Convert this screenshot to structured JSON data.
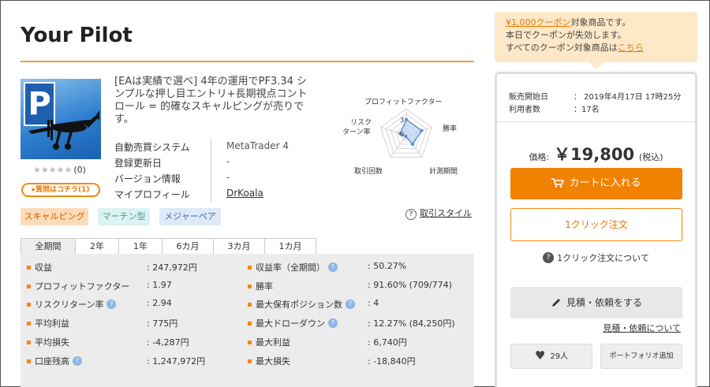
{
  "product": {
    "title": "Your Pilot",
    "description": "[EAは実績で選べ] 4年の運用でPF3.34 シンプルな押し目エントリ+長期視点コントロール = 的確なスキャルピングが売りです。",
    "rating_stars": "★★★★★",
    "rating_count": "(0)",
    "question_button": "▸質問はコチラ(1)",
    "info": [
      {
        "key": "自動売買システム",
        "value": "MetaTrader 4"
      },
      {
        "key": "登録更新日",
        "value": "-"
      },
      {
        "key": "バージョン情報",
        "value": "-"
      },
      {
        "key": "マイプロフィール",
        "value": "DrKoala"
      }
    ],
    "tags": [
      "スキャルピング",
      "マーチン型",
      "メジャーペア"
    ],
    "trade_style_link": "取引スタイル"
  },
  "radar": {
    "labels": {
      "top": "プロフィットファクター",
      "right": "勝率",
      "bottom_right": "計測期間",
      "bottom_left": "取引回数",
      "left_line1": "リスク",
      "left_line2": "ターン率"
    },
    "scale_labels": [
      "3",
      "0"
    ],
    "axes": [
      "プロフィットファクター",
      "勝率",
      "計測期間",
      "取引回数",
      "リスクリターン率"
    ],
    "values": [
      3,
      3,
      2,
      0.2,
      1.2
    ],
    "max": 5,
    "colors": {
      "grid": "#cccccc",
      "fill": "#a9c8ee",
      "stroke": "#5b93d6"
    }
  },
  "tabs": [
    "全期間",
    "2年",
    "1年",
    "6カ月",
    "3カ月",
    "1カ月"
  ],
  "active_tab": 0,
  "stats_left": [
    {
      "label": "収益",
      "value": ": 247,972円",
      "help": false
    },
    {
      "label": "プロフィットファクター",
      "value": ": 1.97",
      "help": false
    },
    {
      "label": "リスクリターン率",
      "value": ": 2.94",
      "help": true
    },
    {
      "label": "平均利益",
      "value": ": 775円",
      "help": false
    },
    {
      "label": "平均損失",
      "value": ": -4,287円",
      "help": false
    },
    {
      "label": "口座残高",
      "value": ": 1,247,972円",
      "help": true
    }
  ],
  "stats_right": [
    {
      "label": "収益率（全期間）",
      "value": ": 50.27%",
      "help": true
    },
    {
      "label": "勝率",
      "value": ": 91.60% (709/774)",
      "help": false
    },
    {
      "label": "最大保有ポジション数",
      "value": ": 4",
      "help": true
    },
    {
      "label": "最大ドローダウン",
      "value": ": 12.27% (84,250円)",
      "help": true
    },
    {
      "label": "最大利益",
      "value": ": 6,740円",
      "help": false
    },
    {
      "label": "最大損失",
      "value": ": -18,840円",
      "help": false
    }
  ],
  "coupon": {
    "link": "¥1,000クーポン",
    "line1_rest": "対象商品です。",
    "line2": "本日でクーポンが失効します。",
    "line3_prefix": "すべてのクーポン対象商品は",
    "line3_link": "こちら"
  },
  "sidebar": {
    "sale_start_label": "販売開始日",
    "sale_start_value": "： 2019年4月17日 17時25分",
    "users_label": "利用者数",
    "users_value": "：17名",
    "price_label": "価格:",
    "price_value": "￥19,800",
    "price_tax": "(税込)",
    "cart_button": "カートに入れる",
    "oneclick_button": "1クリック注文",
    "oneclick_help": "1クリック注文について",
    "quote_button": "見積・依頼をする",
    "quote_help": "見積・依頼について",
    "favorites": "29人",
    "portfolio_button": "ポートフォリオ追加"
  },
  "colors": {
    "accent": "#f08200",
    "link": "#e87800",
    "panel": "#ececec"
  }
}
